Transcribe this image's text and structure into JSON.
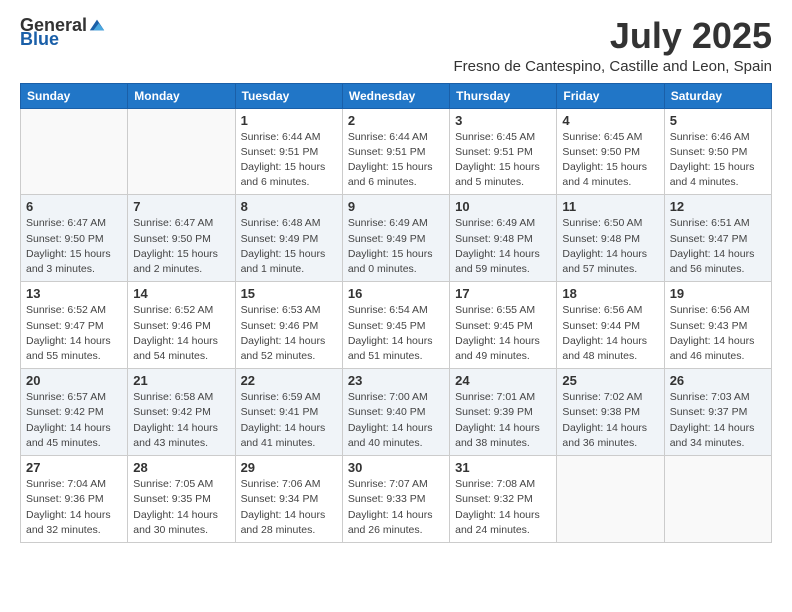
{
  "header": {
    "logo_general": "General",
    "logo_blue": "Blue",
    "title": "July 2025",
    "subtitle": "Fresno de Cantespino, Castille and Leon, Spain"
  },
  "days_of_week": [
    "Sunday",
    "Monday",
    "Tuesday",
    "Wednesday",
    "Thursday",
    "Friday",
    "Saturday"
  ],
  "weeks": [
    [
      {
        "day": "",
        "info": ""
      },
      {
        "day": "",
        "info": ""
      },
      {
        "day": "1",
        "info": "Sunrise: 6:44 AM\nSunset: 9:51 PM\nDaylight: 15 hours and 6 minutes."
      },
      {
        "day": "2",
        "info": "Sunrise: 6:44 AM\nSunset: 9:51 PM\nDaylight: 15 hours and 6 minutes."
      },
      {
        "day": "3",
        "info": "Sunrise: 6:45 AM\nSunset: 9:51 PM\nDaylight: 15 hours and 5 minutes."
      },
      {
        "day": "4",
        "info": "Sunrise: 6:45 AM\nSunset: 9:50 PM\nDaylight: 15 hours and 4 minutes."
      },
      {
        "day": "5",
        "info": "Sunrise: 6:46 AM\nSunset: 9:50 PM\nDaylight: 15 hours and 4 minutes."
      }
    ],
    [
      {
        "day": "6",
        "info": "Sunrise: 6:47 AM\nSunset: 9:50 PM\nDaylight: 15 hours and 3 minutes."
      },
      {
        "day": "7",
        "info": "Sunrise: 6:47 AM\nSunset: 9:50 PM\nDaylight: 15 hours and 2 minutes."
      },
      {
        "day": "8",
        "info": "Sunrise: 6:48 AM\nSunset: 9:49 PM\nDaylight: 15 hours and 1 minute."
      },
      {
        "day": "9",
        "info": "Sunrise: 6:49 AM\nSunset: 9:49 PM\nDaylight: 15 hours and 0 minutes."
      },
      {
        "day": "10",
        "info": "Sunrise: 6:49 AM\nSunset: 9:48 PM\nDaylight: 14 hours and 59 minutes."
      },
      {
        "day": "11",
        "info": "Sunrise: 6:50 AM\nSunset: 9:48 PM\nDaylight: 14 hours and 57 minutes."
      },
      {
        "day": "12",
        "info": "Sunrise: 6:51 AM\nSunset: 9:47 PM\nDaylight: 14 hours and 56 minutes."
      }
    ],
    [
      {
        "day": "13",
        "info": "Sunrise: 6:52 AM\nSunset: 9:47 PM\nDaylight: 14 hours and 55 minutes."
      },
      {
        "day": "14",
        "info": "Sunrise: 6:52 AM\nSunset: 9:46 PM\nDaylight: 14 hours and 54 minutes."
      },
      {
        "day": "15",
        "info": "Sunrise: 6:53 AM\nSunset: 9:46 PM\nDaylight: 14 hours and 52 minutes."
      },
      {
        "day": "16",
        "info": "Sunrise: 6:54 AM\nSunset: 9:45 PM\nDaylight: 14 hours and 51 minutes."
      },
      {
        "day": "17",
        "info": "Sunrise: 6:55 AM\nSunset: 9:45 PM\nDaylight: 14 hours and 49 minutes."
      },
      {
        "day": "18",
        "info": "Sunrise: 6:56 AM\nSunset: 9:44 PM\nDaylight: 14 hours and 48 minutes."
      },
      {
        "day": "19",
        "info": "Sunrise: 6:56 AM\nSunset: 9:43 PM\nDaylight: 14 hours and 46 minutes."
      }
    ],
    [
      {
        "day": "20",
        "info": "Sunrise: 6:57 AM\nSunset: 9:42 PM\nDaylight: 14 hours and 45 minutes."
      },
      {
        "day": "21",
        "info": "Sunrise: 6:58 AM\nSunset: 9:42 PM\nDaylight: 14 hours and 43 minutes."
      },
      {
        "day": "22",
        "info": "Sunrise: 6:59 AM\nSunset: 9:41 PM\nDaylight: 14 hours and 41 minutes."
      },
      {
        "day": "23",
        "info": "Sunrise: 7:00 AM\nSunset: 9:40 PM\nDaylight: 14 hours and 40 minutes."
      },
      {
        "day": "24",
        "info": "Sunrise: 7:01 AM\nSunset: 9:39 PM\nDaylight: 14 hours and 38 minutes."
      },
      {
        "day": "25",
        "info": "Sunrise: 7:02 AM\nSunset: 9:38 PM\nDaylight: 14 hours and 36 minutes."
      },
      {
        "day": "26",
        "info": "Sunrise: 7:03 AM\nSunset: 9:37 PM\nDaylight: 14 hours and 34 minutes."
      }
    ],
    [
      {
        "day": "27",
        "info": "Sunrise: 7:04 AM\nSunset: 9:36 PM\nDaylight: 14 hours and 32 minutes."
      },
      {
        "day": "28",
        "info": "Sunrise: 7:05 AM\nSunset: 9:35 PM\nDaylight: 14 hours and 30 minutes."
      },
      {
        "day": "29",
        "info": "Sunrise: 7:06 AM\nSunset: 9:34 PM\nDaylight: 14 hours and 28 minutes."
      },
      {
        "day": "30",
        "info": "Sunrise: 7:07 AM\nSunset: 9:33 PM\nDaylight: 14 hours and 26 minutes."
      },
      {
        "day": "31",
        "info": "Sunrise: 7:08 AM\nSunset: 9:32 PM\nDaylight: 14 hours and 24 minutes."
      },
      {
        "day": "",
        "info": ""
      },
      {
        "day": "",
        "info": ""
      }
    ]
  ]
}
